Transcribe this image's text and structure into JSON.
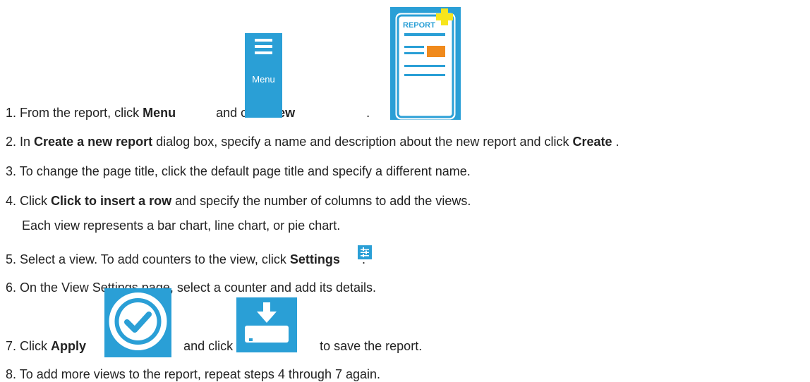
{
  "steps": [
    {
      "n": "1.",
      "t1": "From the report, click ",
      "b1": "Menu",
      "t2": " and click ",
      "b2": "New",
      "t3": "."
    },
    {
      "n": "2.",
      "t1": "In ",
      "b1": "Create a new report",
      "t2": " dialog box, specify a name and description about the new report and click ",
      "b2": "Create",
      "t3": "."
    },
    {
      "n": "3.",
      "t1": "To change the page title, click the default page title and specify a different name."
    },
    {
      "n": "4.",
      "t1": "Click ",
      "b1": "Click to insert a row",
      "t2": " and specify the number of columns to add the views.",
      "sub": "Each view represents a bar chart, line chart, or pie chart."
    },
    {
      "n": "5.",
      "t1": "Select a view. To add counters to the view, click ",
      "b1": "Settings",
      "t2": "."
    },
    {
      "n": "6.",
      "t1": "On the View Settings page, select a counter and add its details."
    },
    {
      "n": "7.",
      "t1": "Click ",
      "b1": "Apply",
      "t2": " and click ",
      "t3": " to save the report."
    },
    {
      "n": "8.",
      "t1": "To add more views to the report, repeat steps 4 through 7 again."
    }
  ],
  "icons": {
    "menu_label": "Menu",
    "report_label": "REPORT",
    "menu_icon": "hamburger-menu-icon",
    "new_icon": "new-report-icon",
    "settings_icon": "sliders-icon",
    "apply_icon": "checkmark-circle-icon",
    "save_icon": "download-tray-icon"
  },
  "colors": {
    "icon_blue": "#2a9fd6",
    "report_orange": "#f08a1c",
    "plus_yellow": "#f7e51d",
    "text": "#222222"
  }
}
